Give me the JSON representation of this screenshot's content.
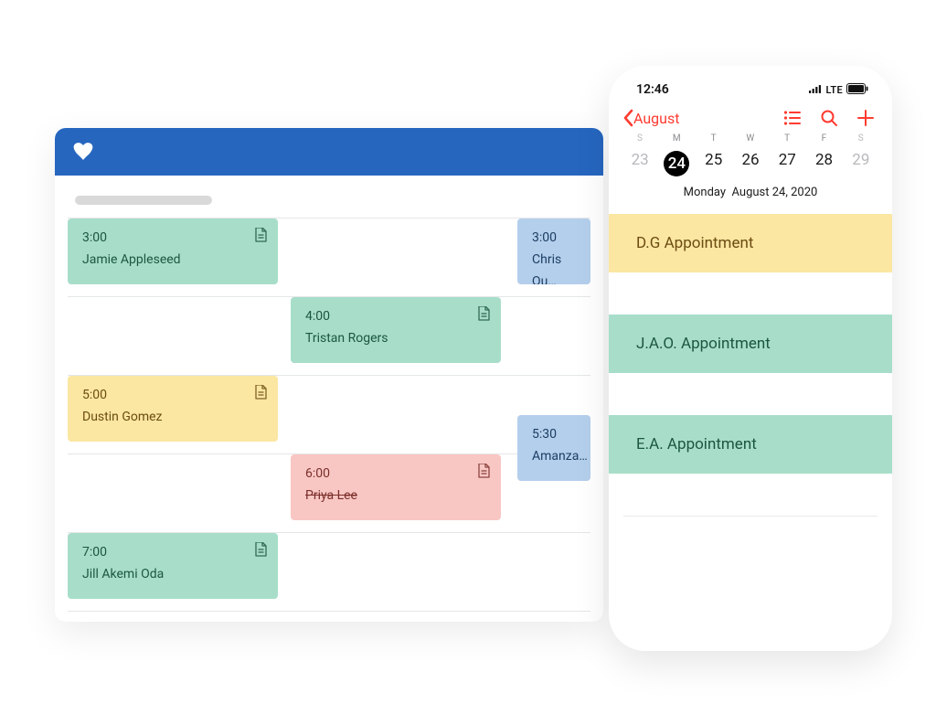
{
  "desktop": {
    "events": [
      {
        "time": "3:00",
        "name": "Jamie Appleseed",
        "color": "green",
        "row": 0,
        "col": 0,
        "has_doc": true
      },
      {
        "time": "3:00",
        "name": "Chris Qu…",
        "color": "blue",
        "row": 0,
        "col": 2,
        "has_doc": false
      },
      {
        "time": "4:00",
        "name": "Tristan Rogers",
        "color": "green",
        "row": 1,
        "col": 1,
        "has_doc": true
      },
      {
        "time": "5:00",
        "name": "Dustin Gomez",
        "color": "yellow",
        "row": 2,
        "col": 0,
        "has_doc": true
      },
      {
        "time": "5:30",
        "name": "Amanza…",
        "color": "blue",
        "row": 2,
        "col": 2,
        "half": true,
        "has_doc": false
      },
      {
        "time": "6:00",
        "name": "Priya Lee",
        "color": "pink",
        "row": 3,
        "col": 1,
        "strike": true,
        "has_doc": true
      },
      {
        "time": "7:00",
        "name": "Jill Akemi Oda",
        "color": "green",
        "row": 4,
        "col": 0,
        "has_doc": true
      }
    ]
  },
  "phone": {
    "status_time": "12:46",
    "status_net": "LTE",
    "back_label": "August",
    "weekdays": [
      "S",
      "M",
      "T",
      "W",
      "T",
      "F",
      "S"
    ],
    "days": [
      "23",
      "24",
      "25",
      "26",
      "27",
      "28",
      "29"
    ],
    "selected_index": 1,
    "full_date_left": "Monday",
    "full_date_right": "August 24, 2020",
    "appointments": [
      {
        "label": "D.G Appointment",
        "color": "yellow"
      },
      {
        "label": "J.A.O. Appointment",
        "color": "green"
      },
      {
        "label": "E.A. Appointment",
        "color": "green"
      }
    ]
  }
}
